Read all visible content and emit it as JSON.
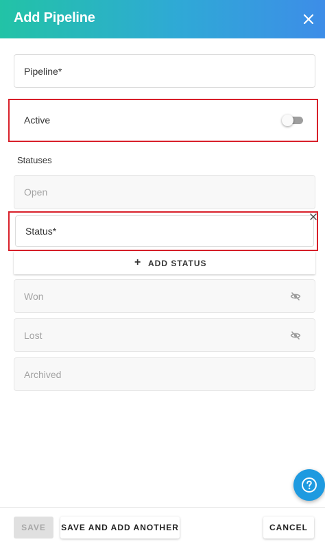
{
  "header": {
    "title": "Add Pipeline"
  },
  "form": {
    "pipeline_label": "Pipeline*",
    "active_label": "Active",
    "active_enabled": false,
    "statuses_title": "Statuses",
    "statuses": {
      "open": "Open",
      "new_status": "Status*",
      "won": "Won",
      "lost": "Lost",
      "archived": "Archived"
    },
    "add_status_label": "ADD STATUS"
  },
  "footer": {
    "save_label": "SAVE",
    "save_add_label": "SAVE AND ADD ANOTHER",
    "cancel_label": "CANCEL"
  },
  "colors": {
    "header_gradient_start": "#22c3a6",
    "header_gradient_end": "#3d8de8",
    "highlight": "#d8202a",
    "help_fab": "#1e9ae0"
  },
  "icons": [
    "close-icon",
    "plus-icon",
    "eye-off-icon",
    "help-icon",
    "remove-icon"
  ]
}
